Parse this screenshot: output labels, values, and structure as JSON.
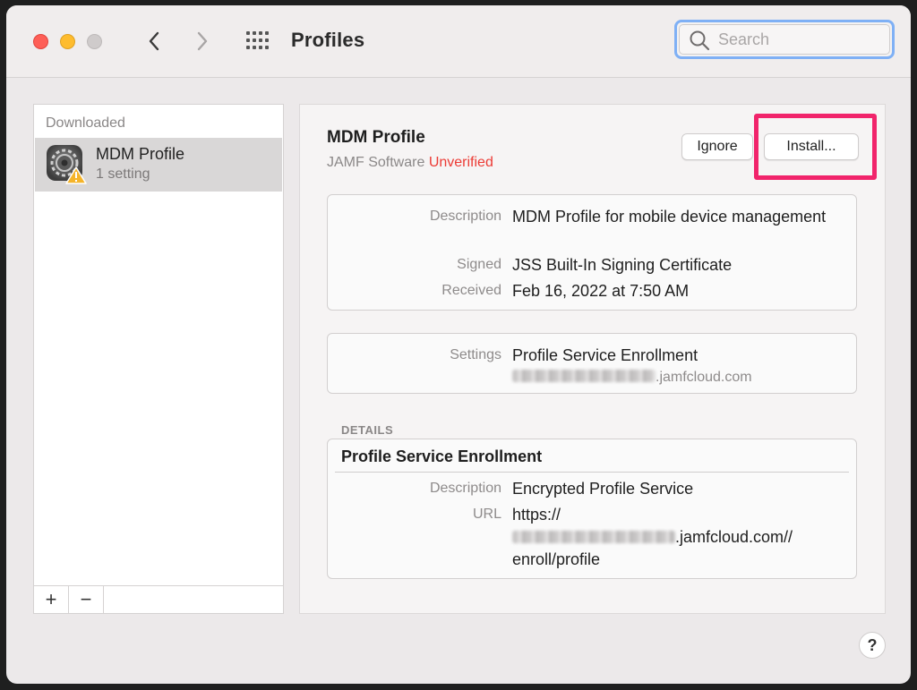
{
  "window": {
    "title": "Profiles",
    "traffic_lights": [
      "close",
      "minimize",
      "zoom-disabled"
    ]
  },
  "toolbar": {
    "back_icon": "chevron-left-icon",
    "forward_icon": "chevron-right-icon",
    "grid_icon": "grid-icon",
    "search": {
      "placeholder": "Search",
      "value": ""
    }
  },
  "sidebar": {
    "heading": "Downloaded",
    "items": [
      {
        "name": "MDM Profile",
        "subtitle": "1 setting",
        "icon": "gear-warning-icon",
        "selected": true
      }
    ],
    "footer": {
      "add": "+",
      "remove": "−"
    }
  },
  "profile": {
    "title": "MDM Profile",
    "publisher": "JAMF Software",
    "status": "Unverified",
    "status_color": "#ec3b35",
    "buttons": {
      "ignore": "Ignore",
      "install": "Install..."
    },
    "summary": [
      {
        "label": "Description",
        "value": "MDM Profile for mobile device management"
      },
      {
        "label": "Signed",
        "value": "JSS Built-In Signing Certificate"
      },
      {
        "label": "Received",
        "value": "Feb 16, 2022 at 7:50 AM"
      }
    ],
    "settings": {
      "label": "Settings",
      "value": "Profile Service Enrollment",
      "host_suffix": ".jamfcloud.com"
    },
    "details_heading": "DETAILS",
    "details": {
      "title": "Profile Service Enrollment",
      "description_label": "Description",
      "description_value": "Encrypted Profile Service",
      "url_label": "URL",
      "url_line1": "https://",
      "url_line2_suffix": ".jamfcloud.com//",
      "url_line3": "enroll/profile"
    }
  },
  "help_label": "?",
  "colors": {
    "highlight": "#f1246b",
    "search_focus": "#7fb0f5"
  }
}
